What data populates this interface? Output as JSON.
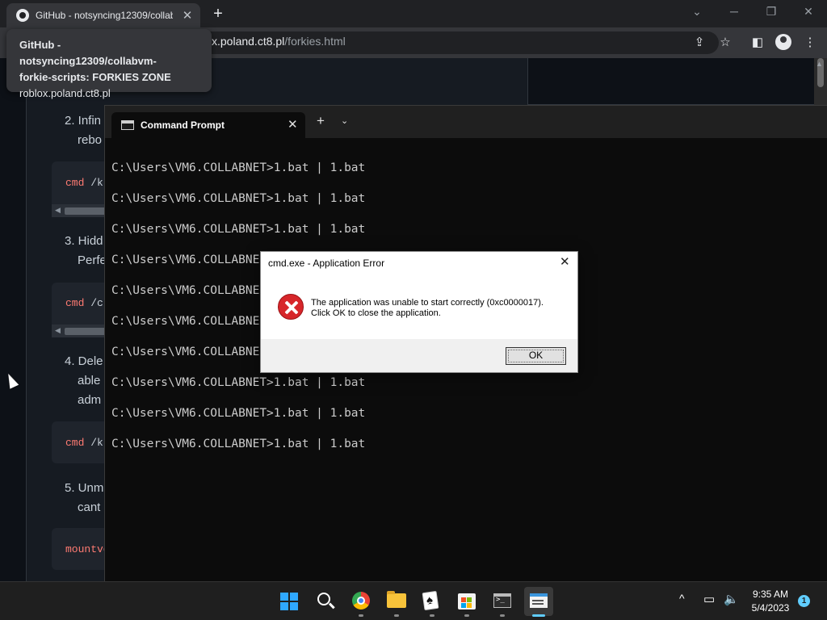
{
  "browser": {
    "tab_title": "GitHub - notsyncing12309/collab",
    "tab_close": "✕",
    "newtab_label": "+",
    "url_domain_visible": "x.poland.ct8.pl",
    "url_path": "/forkies.html",
    "hovercard": {
      "title_line1": "GitHub - notsyncing12309/collabvm-",
      "title_line2": "forkie-scripts: FORKIES ZONE",
      "domain": "roblox.poland.ct8.pl"
    }
  },
  "page": {
    "steps": [
      {
        "line1": "2. Infin",
        "line2": "rebo"
      },
      {
        "line1": "3. Hidd",
        "line2": "Perfe"
      },
      {
        "line1": "4. Dele",
        "line2": "able",
        "line3": "adm"
      },
      {
        "line1": "5. Unm",
        "line2": "cant"
      }
    ],
    "code_blocks": [
      {
        "kw": "cmd",
        "arg": "/k"
      },
      {
        "kw": "cmd",
        "arg": "/c"
      },
      {
        "kw": "cmd",
        "arg": "/k"
      },
      {
        "kw": "mountvo",
        "arg": ""
      }
    ]
  },
  "terminal": {
    "tab_title": "Command Prompt",
    "tab_close": "✕",
    "newtab_label": "+",
    "dropdown_label": "⌄",
    "lines": [
      "C:\\Users\\VM6.COLLABNET>1.bat | 1.bat",
      "C:\\Users\\VM6.COLLABNET>1.bat | 1.bat",
      "C:\\Users\\VM6.COLLABNET>1.bat | 1.bat",
      "C:\\Users\\VM6.COLLABNE",
      "C:\\Users\\VM6.COLLABNE",
      "C:\\Users\\VM6.COLLABNE",
      "C:\\Users\\VM6.COLLABNE",
      "C:\\Users\\VM6.COLLABNET>1.bat | 1.bat",
      "C:\\Users\\VM6.COLLABNET>1.bat | 1.bat",
      "C:\\Users\\VM6.COLLABNET>1.bat | 1.bat"
    ]
  },
  "dialog": {
    "title": "cmd.exe - Application Error",
    "close_label": "✕",
    "message_line1": "The application was unable to start correctly (0xc0000017).",
    "message_line2": "Click OK to close the application.",
    "ok_label": "OK",
    "icon": "error-icon",
    "error_color": "#d7262a"
  },
  "taskbar": {
    "apps": [
      "start-icon",
      "search-icon",
      "chrome-icon",
      "file-explorer-icon",
      "solitaire-icon",
      "microsoft-store-icon",
      "command-prompt-icon",
      "windows-terminal-icon"
    ],
    "tray_chevron": "^",
    "clock_time": "9:35 AM",
    "clock_date": "5/4/2023",
    "notification_count": "1",
    "accent_color": "#60cdff"
  }
}
